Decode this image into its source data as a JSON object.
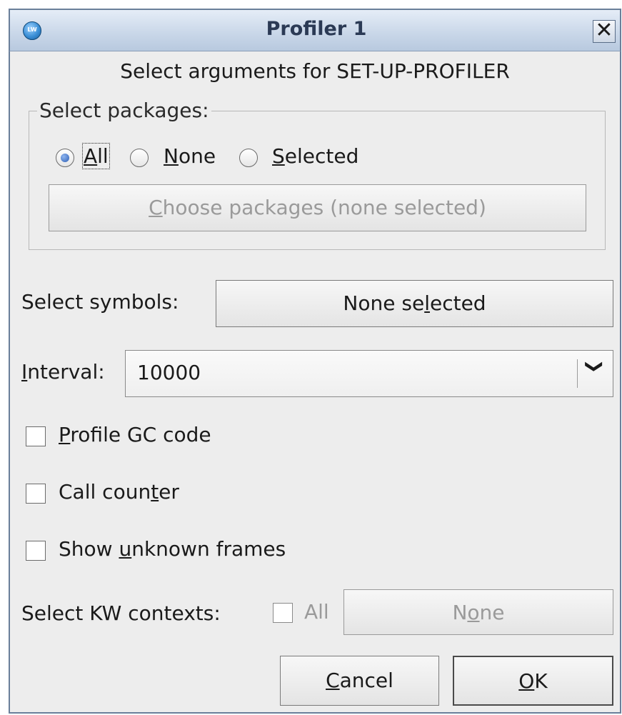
{
  "window": {
    "title": "Profiler 1",
    "app_icon_text": "LW",
    "close_glyph": "✕"
  },
  "dialog": {
    "heading": "Select arguments for SET-UP-PROFILER"
  },
  "packages": {
    "legend": "Select packages:",
    "options": [
      {
        "mnemonic": "A",
        "rest": "ll",
        "selected": true
      },
      {
        "mnemonic": "N",
        "rest": "one",
        "selected": false
      },
      {
        "mnemonic": "S",
        "rest": "elected",
        "selected": false
      }
    ],
    "choose_button": {
      "mnemonic": "C",
      "rest": "hoose packages (none selected)",
      "enabled": false
    }
  },
  "symbols": {
    "label": "Select symbols:",
    "button": {
      "before": "None se",
      "mnemonic": "l",
      "after": "ected"
    }
  },
  "interval": {
    "label_mnemonic": "I",
    "label_rest": "nterval:",
    "value": "10000",
    "dropdown_glyph": "❯"
  },
  "checkboxes": [
    {
      "before": "",
      "mnemonic": "P",
      "after": "rofile GC code",
      "checked": false
    },
    {
      "before": "Call coun",
      "mnemonic": "t",
      "after": "er",
      "checked": false
    },
    {
      "before": "Show ",
      "mnemonic": "u",
      "after": "nknown frames",
      "checked": false
    }
  ],
  "kw_contexts": {
    "label": "Select KW contexts:",
    "all_label": "All",
    "button": {
      "before": "N",
      "mnemonic": "o",
      "after": "ne",
      "enabled": false
    }
  },
  "actions": {
    "cancel": {
      "mnemonic": "C",
      "rest": "ancel"
    },
    "ok": {
      "mnemonic": "O",
      "rest": "K"
    }
  },
  "colors": {
    "titlebar_top": "#e5edf7",
    "titlebar_bottom": "#b8c9df",
    "window_bg": "#ededed",
    "disabled_text": "#9a9a9a",
    "radio_dot": "#2e5fb5"
  }
}
